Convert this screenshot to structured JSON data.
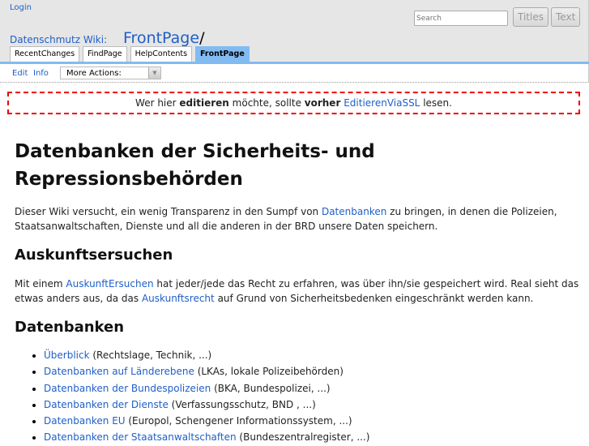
{
  "header": {
    "login": "Login",
    "search_placeholder": "Search",
    "titles_button": "Titles",
    "text_button": "Text",
    "wiki_name": "Datenschmutz Wiki:",
    "page_name": "FrontPage",
    "page_sep": "/",
    "tabs": [
      {
        "label": "RecentChanges"
      },
      {
        "label": "FindPage"
      },
      {
        "label": "HelpContents"
      },
      {
        "label": "FrontPage",
        "active": true
      }
    ]
  },
  "actions": {
    "edit": "Edit",
    "info": "Info",
    "more_actions": "More Actions:"
  },
  "notice": {
    "t1": "Wer hier ",
    "b1": "editieren",
    "t2": " möchte, sollte ",
    "b2": "vorher",
    "t3": " ",
    "link": "EditierenViaSSL",
    "t4": " lesen."
  },
  "content": {
    "title": "Datenbanken der Sicherheits- und Repressionsbehörden",
    "intro": {
      "t1": "Dieser Wiki versucht, ein wenig Transparenz in den Sumpf von ",
      "link": "Datenbanken",
      "t2": " zu bringen, in denen die Polizeien, Staatsanwaltschaften, Dienste und all die anderen in der BRD unsere Daten speichern."
    },
    "h_auskunft": "Auskunftsersuchen",
    "auskunft": {
      "t1": "Mit einem ",
      "link1": "AuskunftErsuchen",
      "t2": " hat jeder/jede das Recht zu erfahren, was über ihn/sie gespeichert wird. Real sieht das etwas anders aus, da das ",
      "link2": "Auskunftsrecht",
      "t3": " auf Grund von Sicherheitsbedenken eingeschränkt werden kann."
    },
    "h_datenbanken": "Datenbanken",
    "list": [
      {
        "link": "Überblick",
        "text": " (Rechtslage, Technik, ...)"
      },
      {
        "link": "Datenbanken auf Länderebene",
        "text": " (LKAs, lokale Polizeibehörden)"
      },
      {
        "link": "Datenbanken der Bundespolizeien",
        "text": " (BKA, Bundespolizei, ...)"
      },
      {
        "link": "Datenbanken der Dienste",
        "text": " (Verfassungsschutz, BND , ...)"
      },
      {
        "link": "Datenbanken EU",
        "text": " (Europol, Schengener Informationssystem, ...)"
      },
      {
        "link": "Datenbanken der Staatsanwaltschaften",
        "text": " (Bundeszentralregister, ...)"
      }
    ]
  }
}
